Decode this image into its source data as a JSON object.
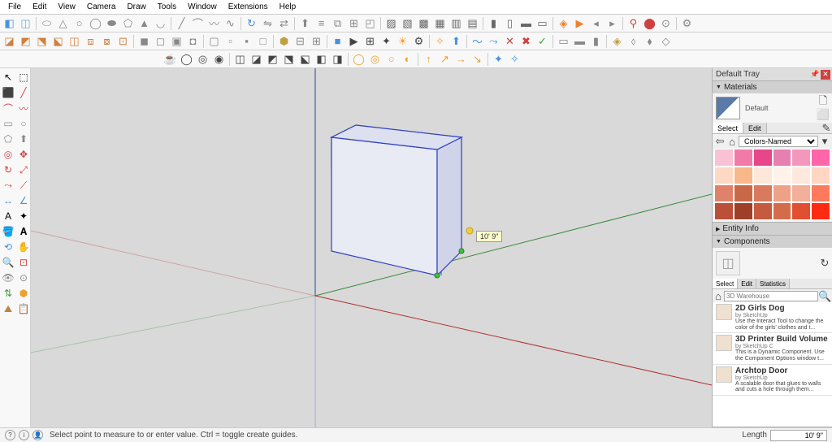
{
  "menu": [
    "File",
    "Edit",
    "View",
    "Camera",
    "Draw",
    "Tools",
    "Window",
    "Extensions",
    "Help"
  ],
  "tray": {
    "title": "Default Tray",
    "materials": {
      "title": "Materials",
      "current_name": "Default",
      "tabs": [
        "Select",
        "Edit"
      ],
      "collection": "Colors-Named",
      "swatches": [
        "#f9c2d4",
        "#f27aa8",
        "#e8468a",
        "#e680b0",
        "#f497bd",
        "#ff66aa",
        "#fdd9c4",
        "#f8b88a",
        "#fde7d8",
        "#fff2e8",
        "#ffe9dc",
        "#ffd6c2",
        "#e0826a",
        "#c96849",
        "#d97a5c",
        "#efa188",
        "#f2b09a",
        "#ff7a5c",
        "#ba5038",
        "#9e3f2a",
        "#c45a3e",
        "#d46c4a",
        "#e05030",
        "#ff2a12"
      ]
    },
    "entity_info": {
      "title": "Entity Info"
    },
    "components": {
      "title": "Components",
      "tabs": [
        "Select",
        "Edit",
        "Statistics"
      ],
      "search_placeholder": "3D Warehouse",
      "items": [
        {
          "title": "2D Girls Dog",
          "author": "by SketchUp",
          "desc": "Use the Interact Tool to change the color of the girls' clothes and t..."
        },
        {
          "title": "3D Printer Build Volume",
          "author": "by SketchUp C",
          "desc": "This is a Dynamic Component. Use the Component Options window t..."
        },
        {
          "title": "Archtop Door",
          "author": "by SketchUp",
          "desc": "A scalable door that glues to walls and cuts a hole through them..."
        }
      ]
    }
  },
  "status": {
    "hint": "Select point to measure to or enter value. Ctrl = toggle create guides.",
    "length_label": "Length",
    "length_value": "10' 9\""
  },
  "viewport": {
    "tooltip": "10' 9\""
  }
}
